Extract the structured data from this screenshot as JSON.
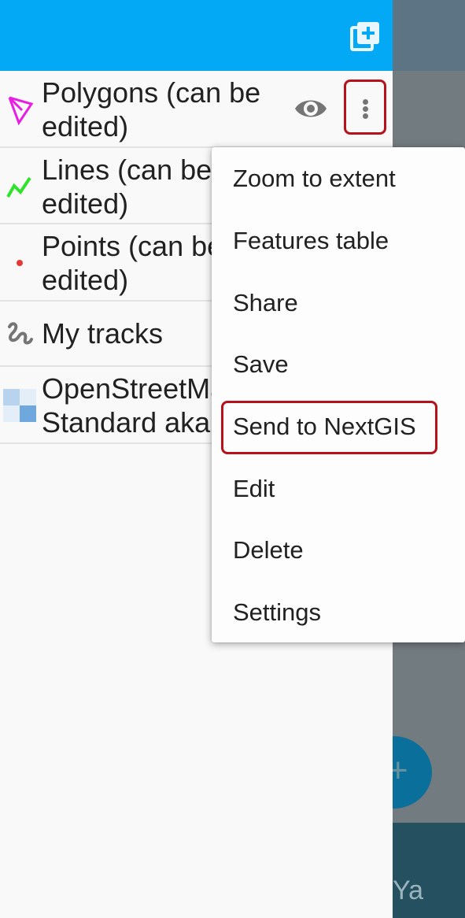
{
  "layers": [
    {
      "name": "Polygons (can be\nedited)",
      "icon": "polygon-icon",
      "color": "#e91ee3"
    },
    {
      "name": "Lines (can be\nedited)",
      "icon": "polyline-icon",
      "color": "#2fe32a"
    },
    {
      "name": "Points (can be\nedited)",
      "icon": "point-icon",
      "color": "#e53935"
    },
    {
      "name": "My tracks",
      "icon": "track-icon",
      "color": "#757575"
    },
    {
      "name": "OpenStreetMap\nStandard aka",
      "icon": "raster-tiles-icon",
      "color": "#6fa8dc"
    }
  ],
  "menu": {
    "items": [
      {
        "label": "Zoom to extent"
      },
      {
        "label": "Features table"
      },
      {
        "label": "Share"
      },
      {
        "label": "Save"
      },
      {
        "label": "Send to NextGIS"
      },
      {
        "label": "Edit"
      },
      {
        "label": "Delete"
      },
      {
        "label": "Settings"
      }
    ],
    "highlighted": "Send to NextGIS"
  },
  "colors": {
    "appbar": "#03a9f4",
    "highlight": "#b5121b"
  },
  "map": {
    "bottom_text": "Ya",
    "fab_icon": "plus-icon"
  }
}
